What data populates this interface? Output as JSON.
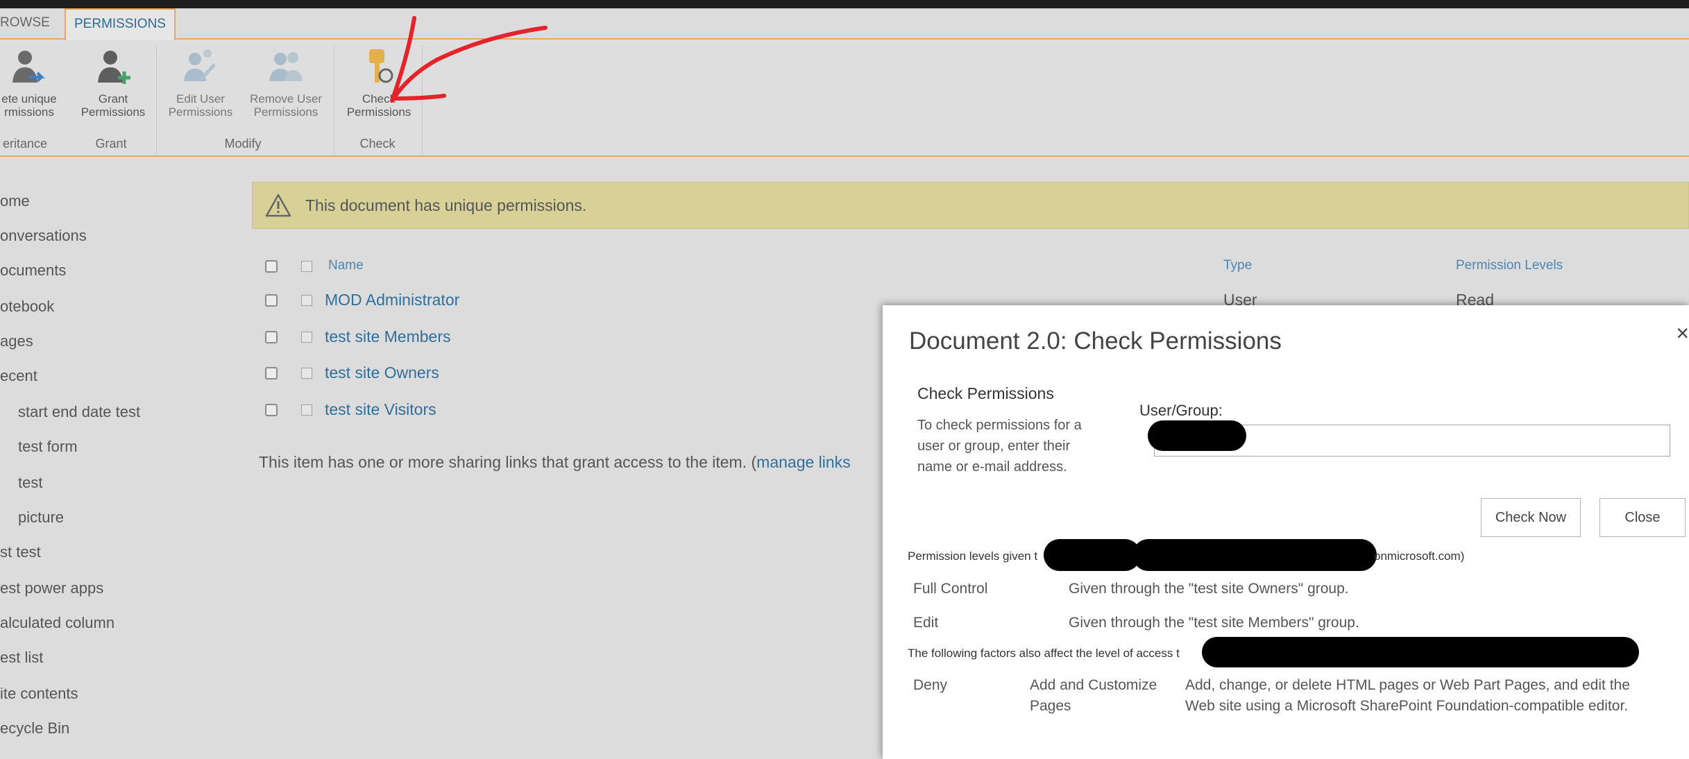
{
  "ribbon": {
    "tabs": {
      "browse": "ROWSE",
      "permissions": "PERMISSIONS"
    },
    "buttons": {
      "delete_unique": [
        "ete unique",
        "rmissions"
      ],
      "grant": [
        "Grant",
        "Permissions"
      ],
      "edit_user": [
        "Edit User",
        "Permissions"
      ],
      "remove_user": [
        "Remove User",
        "Permissions"
      ],
      "check": [
        "Check",
        "Permissions"
      ]
    },
    "groups": {
      "inheritance": "eritance",
      "grant": "Grant",
      "modify": "Modify",
      "check": "Check"
    }
  },
  "nav": {
    "items": [
      "Home",
      "Conversations",
      "Documents",
      "Notebook",
      "Pages",
      "Recent",
      "start end date test",
      "test form",
      "test",
      "picture",
      "st test",
      "est power apps",
      "alculated column",
      "est list",
      "ite contents",
      "ecycle Bin"
    ],
    "visible": {
      "home": "ome",
      "conversations": "onversations",
      "documents": "ocuments",
      "notebook": "otebook",
      "pages": "ages",
      "recent": "ecent"
    }
  },
  "notice": {
    "text": "This document has unique permissions."
  },
  "table": {
    "headers": {
      "name": "Name",
      "type": "Type",
      "levels": "Permission Levels"
    },
    "rows": [
      {
        "name": "MOD Administrator",
        "type": "User",
        "level": "Read"
      },
      {
        "name": "test site Members"
      },
      {
        "name": "test site Owners"
      },
      {
        "name": "test site Visitors"
      }
    ]
  },
  "sharing": {
    "text": "This item has one or more sharing links that grant access to the item. (",
    "link": "manage links"
  },
  "dialog": {
    "title": "Document 2.0: Check Permissions",
    "close_glyph": "×",
    "section_title": "Check Permissions",
    "description": "To check permissions for a user or group, enter their name or e-mail address.",
    "user_group_label": "User/Group:",
    "check_now": "Check Now",
    "close": "Close",
    "levels_given_prefix": "Permission levels given t",
    "levels_given_suffix": "onmicrosoft.com)",
    "permissions": [
      {
        "level": "Full Control",
        "how": "Given through the \"test site Owners\" group."
      },
      {
        "level": "Edit",
        "how": "Given through the \"test site Members\" group."
      }
    ],
    "factors_prefix": "The following factors also affect the level of access t",
    "deny": {
      "kind": "Deny",
      "permission": [
        "Add and Customize",
        "Pages"
      ],
      "description": [
        "Add, change, or delete HTML pages or Web Part Pages, and edit the",
        "Web site using a Microsoft SharePoint Foundation-compatible editor."
      ]
    }
  },
  "colors": {
    "ribbon_accent": "#eaa85a",
    "link": "#2f6f9c",
    "notice_bg": "#d8d197",
    "annotation": "#e5232b"
  }
}
